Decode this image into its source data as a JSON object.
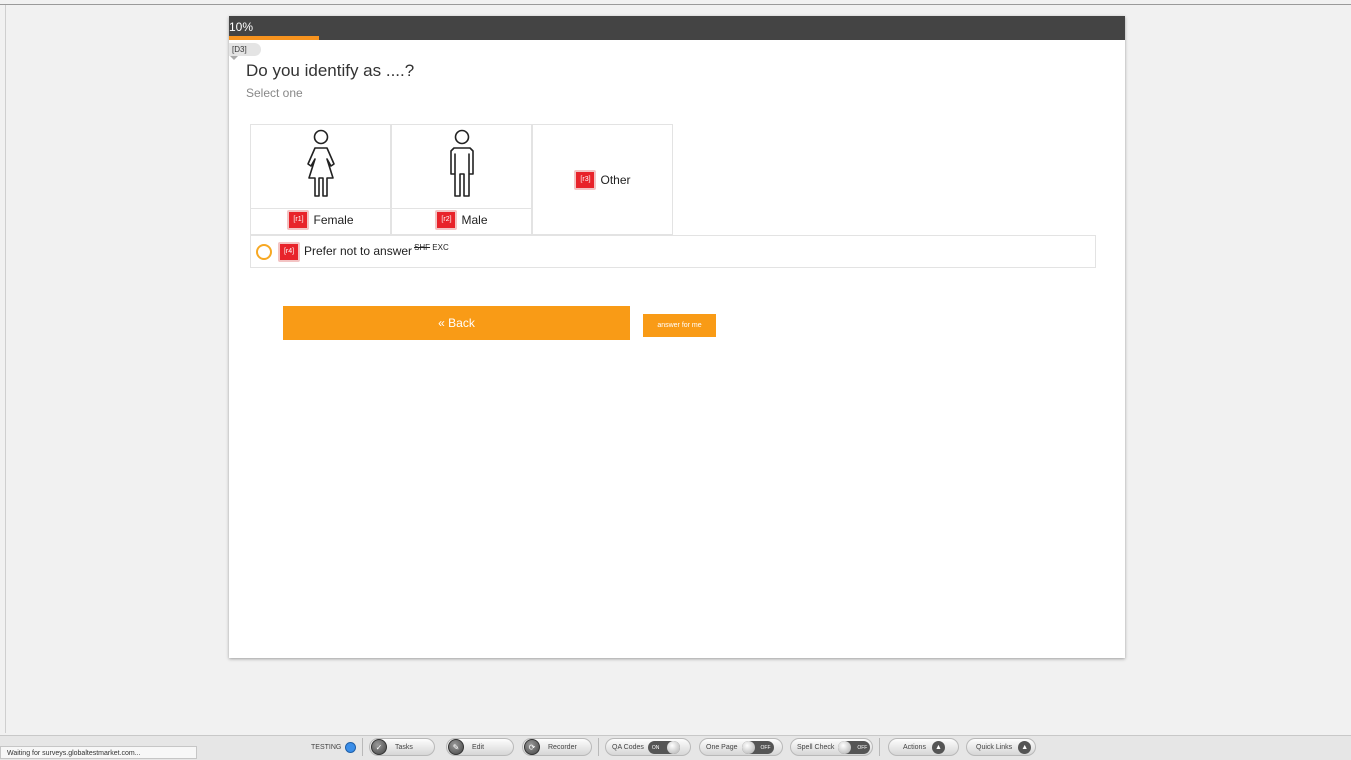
{
  "progress": {
    "label": "10%",
    "fraction": 0.1
  },
  "question": {
    "tag": "[D3]",
    "title": "Do you identify as ....?",
    "instruction": "Select one"
  },
  "options": [
    {
      "code": "[r1]",
      "label": "Female",
      "icon": "female-person-icon"
    },
    {
      "code": "[r2]",
      "label": "Male",
      "icon": "male-person-icon"
    },
    {
      "code": "[r3]",
      "label": "Other"
    }
  ],
  "prefer_not": {
    "code": "[r4]",
    "label": "Prefer not to answer",
    "flag_shf": "SHF",
    "flag_exc": "EXC"
  },
  "buttons": {
    "back": "« Back",
    "answer_for_me": "answer for me"
  },
  "statusbar": {
    "message": "Waiting for surveys.globaltestmarket.com...",
    "testing": "TESTING",
    "tasks": "Tasks",
    "edit": "Edit",
    "recorder": "Recorder",
    "qa_codes": "QA Codes",
    "qa_codes_state": "ON",
    "one_page": "One Page",
    "one_page_state": "OFF",
    "spell_check": "Spell Check",
    "spell_check_state": "OFF",
    "actions": "Actions",
    "quick_links": "Quick Links"
  },
  "colors": {
    "accent": "#f99b16",
    "code_red": "#e8232a",
    "progress_bg": "#444444",
    "testing_dot": "#3b8ee8"
  }
}
